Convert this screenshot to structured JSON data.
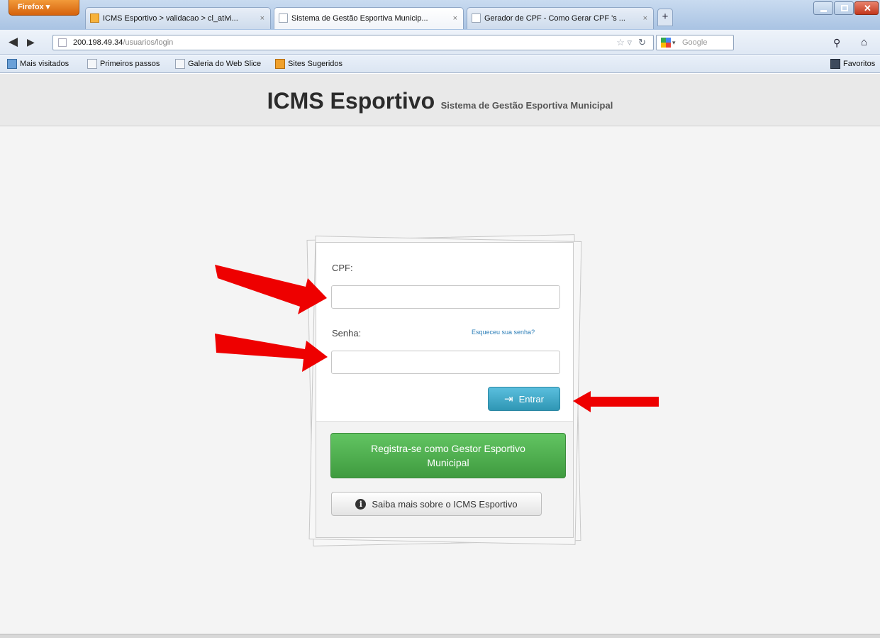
{
  "browser": {
    "firefox_label": "Firefox",
    "tabs": [
      {
        "label": "ICMS Esportivo > validacao > cl_ativi...",
        "close": "×"
      },
      {
        "label": "Sistema de Gestão Esportiva Municip...",
        "close": "×"
      },
      {
        "label": "Gerador de CPF - Como Gerar CPF 's ...",
        "close": "×"
      }
    ],
    "new_tab": "+",
    "url_host": "200.198.49.34",
    "url_path": "/usuarios/login",
    "search_placeholder": "Google",
    "bookmarks": [
      {
        "label": "Mais visitados"
      },
      {
        "label": "Primeiros passos"
      },
      {
        "label": "Galeria do Web Slice"
      },
      {
        "label": "Sites Sugeridos"
      }
    ],
    "favorites_label": "Favoritos"
  },
  "header": {
    "title": "ICMS Esportivo",
    "subtitle": "Sistema de Gestão Esportiva Municipal"
  },
  "login": {
    "cpf_label": "CPF:",
    "cpf_value": "",
    "senha_label": "Senha:",
    "senha_value": "",
    "forgot_link": "Esqueceu sua senha?",
    "submit_label": "Entrar",
    "register_label": "Registra-se como Gestor Esportivo Municipal",
    "info_label": "Saiba mais sobre o ICMS Esportivo"
  },
  "colors": {
    "annotation_arrow": "#ee0000",
    "submit_button": "#2f96b4",
    "register_button": "#4cae4c"
  },
  "icons": {
    "submit": "sign-in-icon",
    "info": "info-circle-icon"
  }
}
